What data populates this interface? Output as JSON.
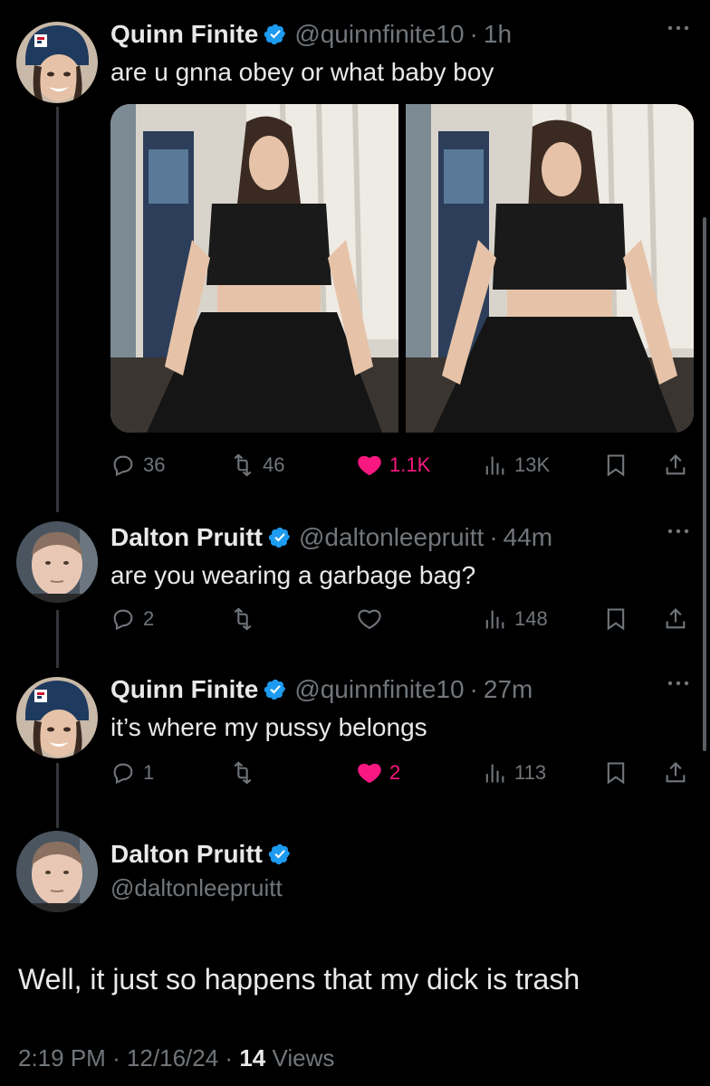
{
  "tweets": [
    {
      "name": "Quinn Finite",
      "handle": "@quinnfinite10",
      "time": "1h",
      "text": "are u gnna obey or what baby boy",
      "stats": {
        "replies": "36",
        "retweets": "46",
        "likes": "1.1K",
        "views": "13K"
      },
      "liked": true
    },
    {
      "name": "Dalton Pruitt",
      "handle": "@daltonleepruitt",
      "time": "44m",
      "text": "are you wearing a garbage bag?",
      "stats": {
        "replies": "2",
        "retweets": "",
        "likes": "",
        "views": "148"
      },
      "liked": false
    },
    {
      "name": "Quinn Finite",
      "handle": "@quinnfinite10",
      "time": "27m",
      "text": "it’s where my pussy belongs",
      "stats": {
        "replies": "1",
        "retweets": "",
        "likes": "2",
        "views": "113"
      },
      "liked": true
    }
  ],
  "main_tweet": {
    "name": "Dalton Pruitt",
    "handle": "@daltonleepruitt",
    "text": "Well, it just so happens that my dick is trash",
    "time": "2:19 PM",
    "date": "12/16/24",
    "views_count": "14",
    "views_label": "Views"
  },
  "separator": "·",
  "colors": {
    "background": "#000000",
    "text": "#e7e9ea",
    "muted": "#71767b",
    "like": "#f91880",
    "verified": "#1d9bf0"
  },
  "icons": [
    "verified-badge-icon",
    "more-icon",
    "reply-icon",
    "retweet-icon",
    "like-icon",
    "views-icon",
    "bookmark-icon",
    "share-icon"
  ]
}
